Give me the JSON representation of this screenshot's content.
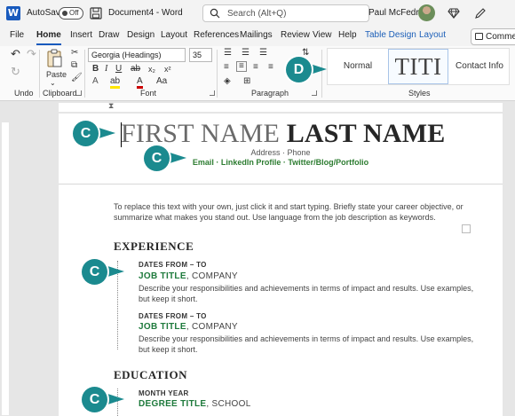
{
  "titlebar": {
    "autosave_label": "AutoSave",
    "autosave_state": "Off",
    "document_title": "Document4 - Word",
    "search_placeholder": "Search (Alt+Q)",
    "user_name": "Paul McFedries"
  },
  "tabs": [
    {
      "label": "File"
    },
    {
      "label": "Home",
      "active": true
    },
    {
      "label": "Insert"
    },
    {
      "label": "Draw"
    },
    {
      "label": "Design"
    },
    {
      "label": "Layout"
    },
    {
      "label": "References"
    },
    {
      "label": "Mailings"
    },
    {
      "label": "Review"
    },
    {
      "label": "View"
    },
    {
      "label": "Help"
    },
    {
      "label": "Table Design",
      "contextual": true
    },
    {
      "label": "Layout",
      "contextual": true
    }
  ],
  "comments_label": "Comments",
  "ribbon": {
    "undo_label": "Undo",
    "clipboard_label": "Clipboard",
    "paste_label": "Paste",
    "font_label": "Font",
    "font_name": "Georgia (Headings)",
    "font_size": "35",
    "paragraph_label": "Paragraph",
    "styles_label": "Styles",
    "style_normal": "Normal",
    "style_title": "TITI",
    "style_contact": "Contact Info"
  },
  "document": {
    "first_name": "FIRST NAME",
    "last_name": "LAST NAME",
    "address_phone": "Address · Phone",
    "contact_line": "Email · LinkedIn Profile · Twitter/Blog/Portfolio",
    "objective_line1": "To replace this text with your own, just click it and start typing. Briefly state your career objective, or",
    "objective_line2": "summarize what makes you stand out. Use language from the job description as keywords.",
    "experience_heading": "EXPERIENCE",
    "jobs": [
      {
        "dates": "DATES FROM – TO",
        "title": "JOB TITLE",
        "company": ", COMPANY",
        "desc1": "Describe your responsibilities and achievements in terms of impact and results. Use examples,",
        "desc2": "but keep it short."
      },
      {
        "dates": "DATES FROM – TO",
        "title": "JOB TITLE",
        "company": ", COMPANY",
        "desc1": "Describe your responsibilities and achievements in terms of impact and results. Use examples,",
        "desc2": "but keep it short."
      }
    ],
    "education_heading": "EDUCATION",
    "education": {
      "date": "MONTH YEAR",
      "degree": "DEGREE TITLE",
      "school": ", SCHOOL"
    }
  },
  "callouts": {
    "c_label": "C",
    "d_label": "D"
  },
  "colors": {
    "accent": "#185abd",
    "callout": "#1b8a8f",
    "green_text": "#1e7a3c"
  }
}
